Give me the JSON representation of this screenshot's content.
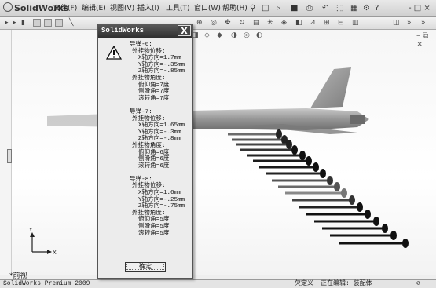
{
  "app": {
    "logo_text": "SolidWorks",
    "menu": [
      "文件(F)",
      "编辑(E)",
      "视图(V)",
      "插入(I)",
      "工具(T)",
      "窗口(W)",
      "帮助(H)"
    ],
    "window_controls": "- □ ×"
  },
  "viewport": {
    "view_label": "*前视",
    "axis_y": "Y",
    "axis_x": "X"
  },
  "dialog": {
    "title": "SolidWorks",
    "close_glyph": "X",
    "ok_label": "确定",
    "lines": [
      {
        "text": "导弹-6:",
        "indent": 0
      },
      {
        "text": "外挂物位移:",
        "indent": 1
      },
      {
        "text": "X轴方向=1.7mm",
        "indent": 2
      },
      {
        "text": "Y轴方向=-.35mm",
        "indent": 2
      },
      {
        "text": "Z轴方向=-.85mm",
        "indent": 2
      },
      {
        "text": "外挂物角度:",
        "indent": 1
      },
      {
        "text": "俯仰角=7度",
        "indent": 2
      },
      {
        "text": "侧滑角=7度",
        "indent": 2
      },
      {
        "text": "滚转角=7度",
        "indent": 2
      },
      {
        "text": "",
        "indent": 0
      },
      {
        "text": "导弹-7:",
        "indent": 0
      },
      {
        "text": "外挂物位移:",
        "indent": 1
      },
      {
        "text": "X轴方向=1.65mm",
        "indent": 2
      },
      {
        "text": "Y轴方向=-.3mm",
        "indent": 2
      },
      {
        "text": "Z轴方向=-.8mm",
        "indent": 2
      },
      {
        "text": "外挂物角度:",
        "indent": 1
      },
      {
        "text": "俯仰角=6度",
        "indent": 2
      },
      {
        "text": "侧滑角=6度",
        "indent": 2
      },
      {
        "text": "滚转角=6度",
        "indent": 2
      },
      {
        "text": "",
        "indent": 0
      },
      {
        "text": "导弹-8:",
        "indent": 0
      },
      {
        "text": "外挂物位移:",
        "indent": 1
      },
      {
        "text": "X轴方向=1.6mm",
        "indent": 2
      },
      {
        "text": "Y轴方向=-.25mm",
        "indent": 2
      },
      {
        "text": "Z轴方向=-.75mm",
        "indent": 2
      },
      {
        "text": "外挂物角度:",
        "indent": 1
      },
      {
        "text": "俯仰角=5度",
        "indent": 2
      },
      {
        "text": "侧滑角=5度",
        "indent": 2
      },
      {
        "text": "滚转角=5度",
        "indent": 2
      }
    ]
  },
  "status": {
    "version": "SolidWorks Premium 2009",
    "define_state": "欠定义",
    "edit_state": "正在编辑: 装配体"
  },
  "colors": {
    "dialog_title_bg": "#3b3b3b",
    "aircraft": "#8a8a8a",
    "missile": "#1a1a1a"
  },
  "icons": {
    "warning": "warning-icon",
    "close": "close-icon"
  }
}
